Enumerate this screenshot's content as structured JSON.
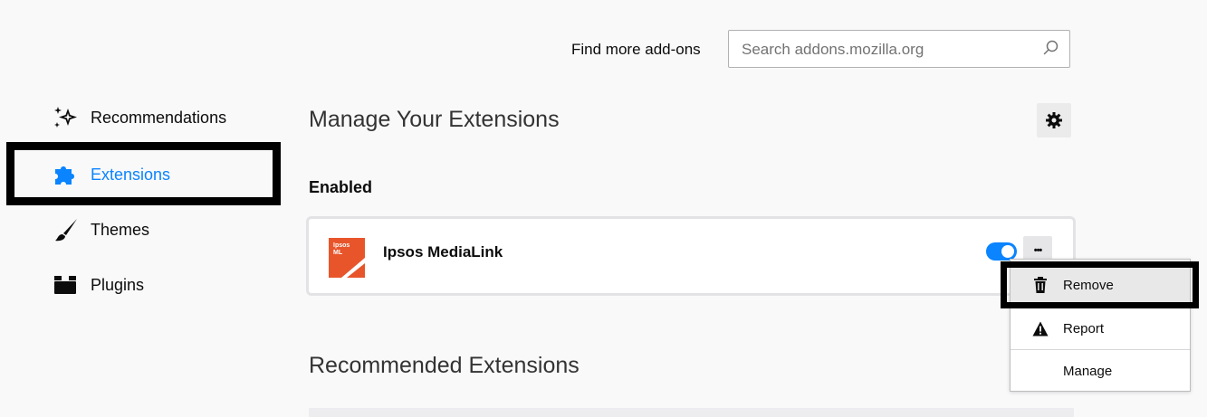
{
  "header": {
    "find_label": "Find more add-ons",
    "search_placeholder": "Search addons.mozilla.org",
    "search_icon": "search-icon"
  },
  "sidebar": {
    "items": [
      {
        "label": "Recommendations",
        "icon": "sparkle-icon",
        "active": false
      },
      {
        "label": "Extensions",
        "icon": "puzzle-icon",
        "active": true
      },
      {
        "label": "Themes",
        "icon": "brush-icon",
        "active": false
      },
      {
        "label": "Plugins",
        "icon": "plugin-icon",
        "active": false
      }
    ]
  },
  "main": {
    "title": "Manage Your Extensions",
    "settings_icon": "gear-icon",
    "enabled_heading": "Enabled",
    "extension": {
      "name": "Ipsos MediaLink",
      "logo_text": "Ipsos ML",
      "enabled": true,
      "more_label": "•••"
    },
    "recommended_heading": "Recommended Extensions"
  },
  "menu": {
    "items": [
      {
        "label": "Remove",
        "icon": "trash-icon"
      },
      {
        "label": "Report",
        "icon": "warning-icon"
      },
      {
        "label": "Manage",
        "icon": ""
      }
    ]
  },
  "colors": {
    "accent": "#0a84ff",
    "logo": "#e8552b",
    "background": "#f9f9fa"
  }
}
